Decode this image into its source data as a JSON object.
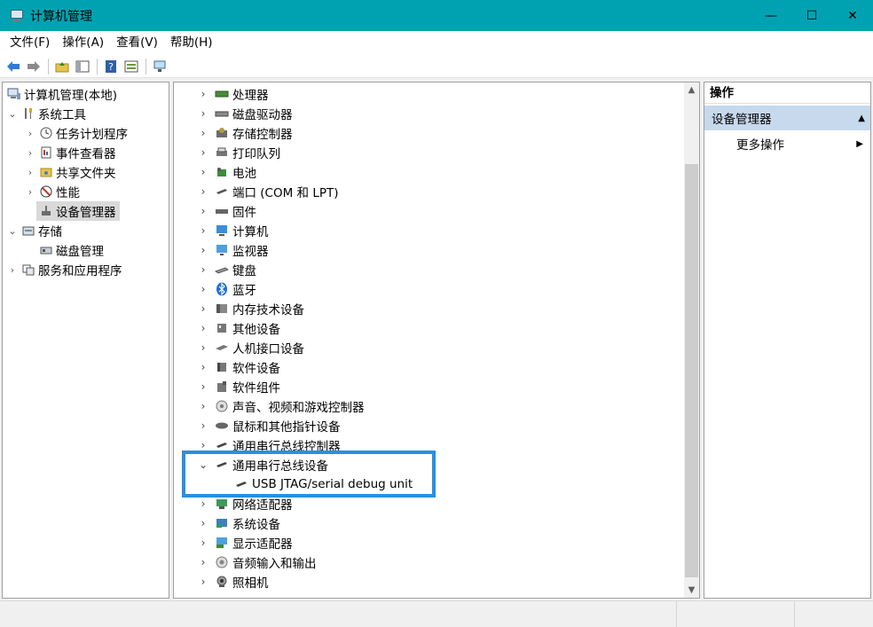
{
  "window": {
    "title": "计算机管理",
    "controls": {
      "minimize": "—",
      "maximize": "☐",
      "close": "✕"
    }
  },
  "menu": {
    "items": [
      "文件(F)",
      "操作(A)",
      "查看(V)",
      "帮助(H)"
    ]
  },
  "toolbar": {
    "icons": [
      "back-arrow-icon",
      "forward-arrow-icon",
      "up-folder-icon",
      "show-hide-tree-icon",
      "help-icon",
      "properties-icon",
      "monitor-icon"
    ]
  },
  "left_tree": {
    "root": "计算机管理(本地)",
    "system_tools": "系统工具",
    "task_scheduler": "任务计划程序",
    "event_viewer": "事件查看器",
    "shared_folders": "共享文件夹",
    "performance": "性能",
    "device_manager": "设备管理器",
    "storage": "存储",
    "disk_management": "磁盘管理",
    "services_apps": "服务和应用程序"
  },
  "device_tree": {
    "items": [
      "处理器",
      "磁盘驱动器",
      "存储控制器",
      "打印队列",
      "电池",
      "端口 (COM 和 LPT)",
      "固件",
      "计算机",
      "监视器",
      "键盘",
      "蓝牙",
      "内存技术设备",
      "其他设备",
      "人机接口设备",
      "软件设备",
      "软件组件",
      "声音、视频和游戏控制器",
      "鼠标和其他指针设备",
      "通用串行总线控制器",
      "通用串行总线设备",
      "USB JTAG/serial debug unit",
      "网络适配器",
      "系统设备",
      "显示适配器",
      "音频输入和输出",
      "照相机"
    ]
  },
  "actions": {
    "header": "操作",
    "group": "设备管理器",
    "more": "更多操作"
  },
  "colors": {
    "titlebar": "#00a2b1",
    "highlight_box": "#2890e0",
    "actions_group_bg": "#c7d9ec"
  }
}
